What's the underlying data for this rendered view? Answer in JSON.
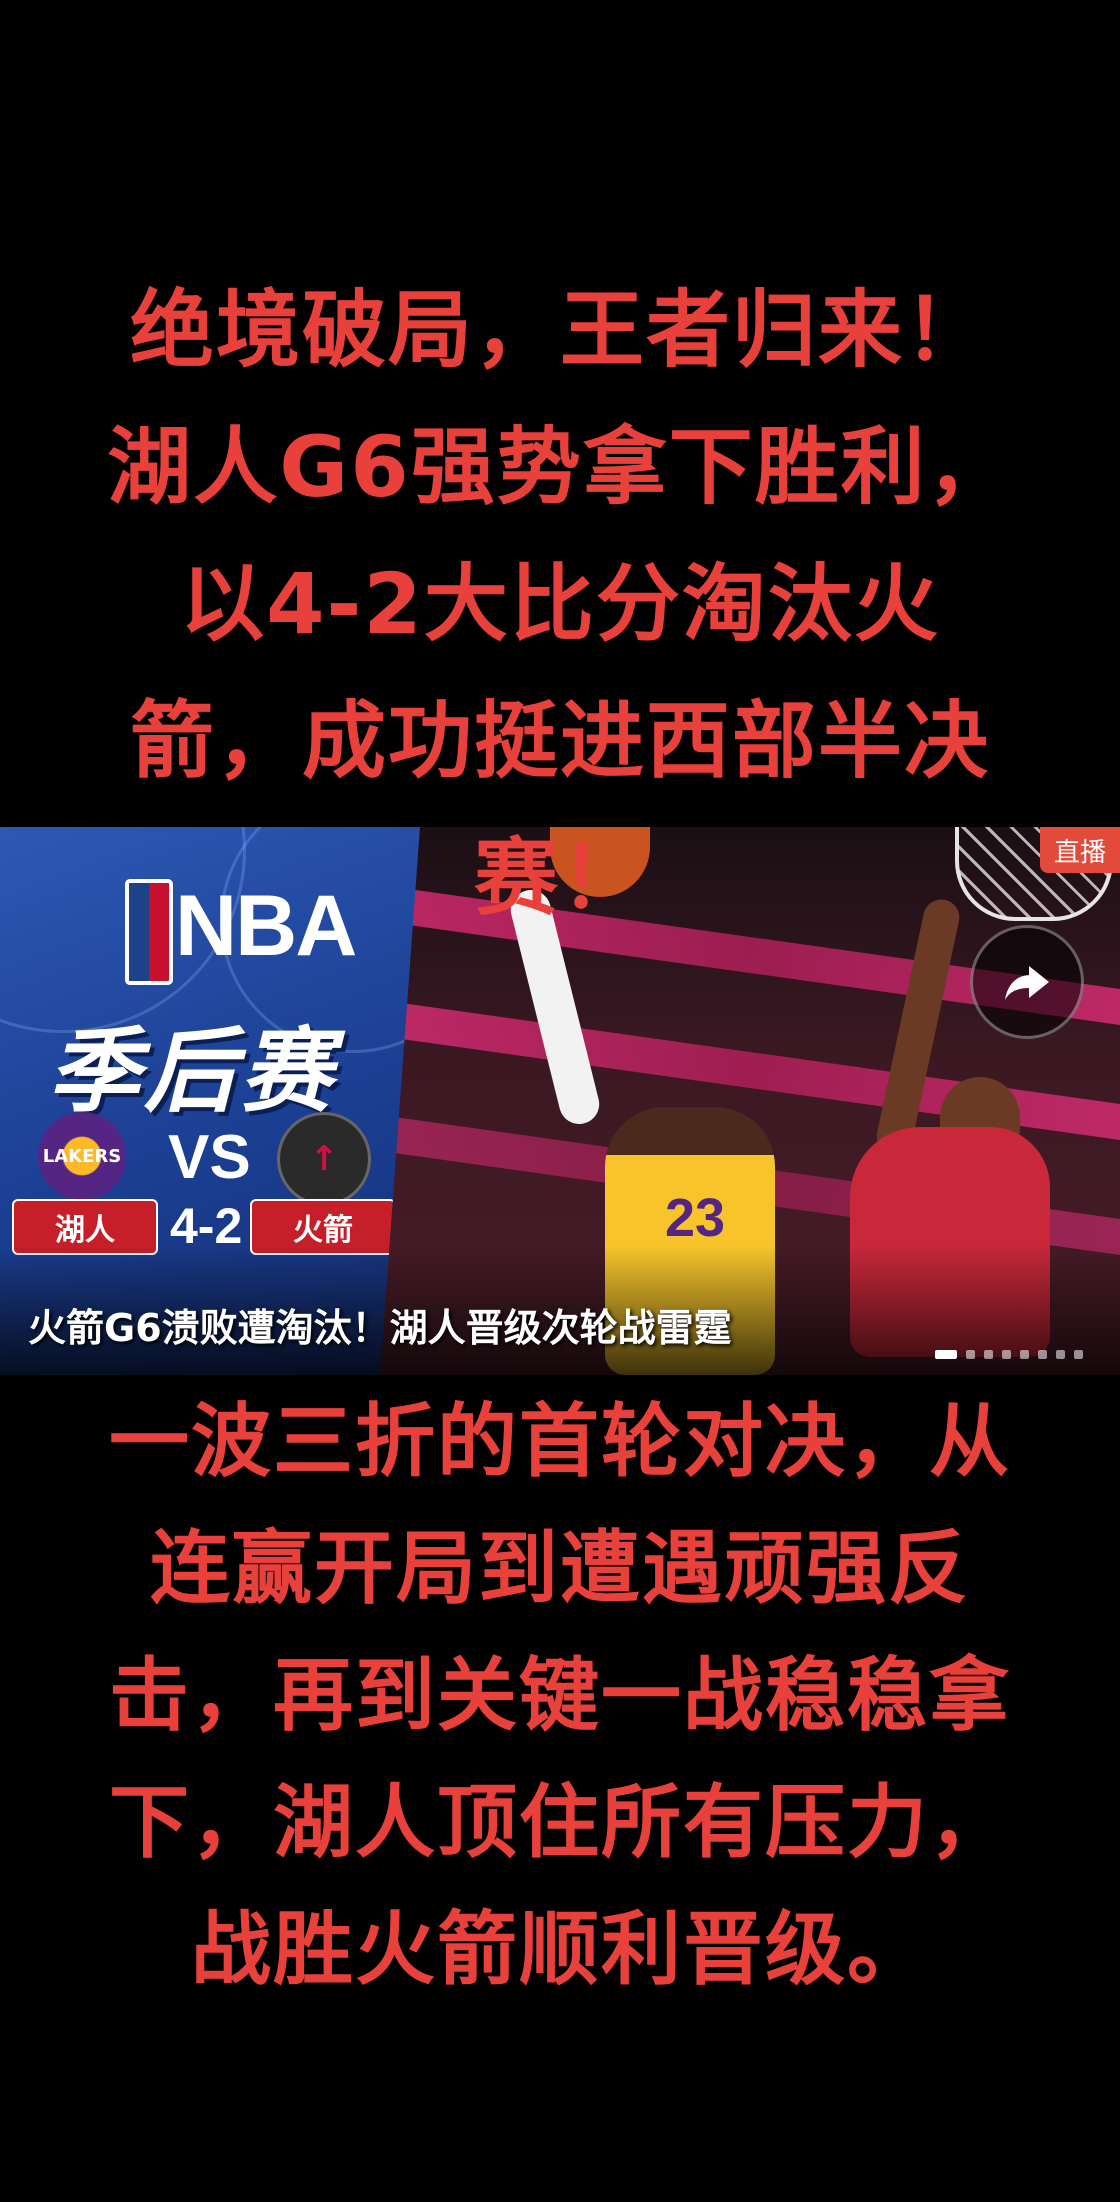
{
  "headline": "绝境破局，王者归来！湖人G6强势拿下胜利，以4-2大比分淘汰火箭，成功挺进西部半决赛！",
  "card": {
    "brand": "NBA",
    "title": "季后赛",
    "vs": "VS",
    "team_home": "湖人",
    "team_away": "火箭",
    "series_score": "4-2",
    "lakers_logo_text": "LAKERS",
    "lebron_number": "23",
    "live_badge": "直播",
    "caption": "火箭G6溃败遭淘汰！湖人晋级次轮战雷霆",
    "pager_count": 8,
    "pager_active": 0
  },
  "body": "一波三折的首轮对决，从连赢开局到遭遇顽强反击，再到关键一战稳稳拿下，湖人顶住所有压力，战胜火箭顺利晋级。",
  "colors": {
    "text_red": "#e8413c",
    "badge": "#e24a3b",
    "lakers_gold": "#fdb927",
    "lakers_purple": "#552583",
    "rockets_red": "#c8283a"
  },
  "icons": {
    "share": "share-arrow-icon"
  }
}
